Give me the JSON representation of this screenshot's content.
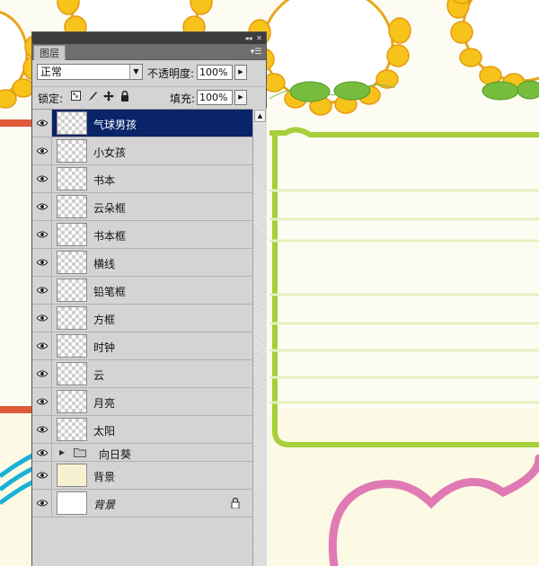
{
  "panel": {
    "tab_label": "图层",
    "collapse_icon": "double-chevron-left-icon",
    "close_icon": "close-icon",
    "menu_icon": "panel-menu-icon",
    "blend_mode": "正常",
    "opacity_label": "不透明度:",
    "opacity_value": "100%",
    "lock_label": "锁定:",
    "fill_label": "填充:",
    "fill_value": "100%"
  },
  "layers": [
    {
      "name": "气球男孩",
      "visible": true,
      "selected": true
    },
    {
      "name": "小女孩",
      "visible": true
    },
    {
      "name": "书本",
      "visible": true
    },
    {
      "name": "云朵框",
      "visible": true
    },
    {
      "name": "书本框",
      "visible": true
    },
    {
      "name": "横线",
      "visible": true
    },
    {
      "name": "铅笔框",
      "visible": true
    },
    {
      "name": "方框",
      "visible": true
    },
    {
      "name": "时钟",
      "visible": true
    },
    {
      "name": "云",
      "visible": true
    },
    {
      "name": "月亮",
      "visible": true
    },
    {
      "name": "太阳",
      "visible": true
    },
    {
      "name": "向日葵",
      "visible": true,
      "type": "group",
      "expanded": false
    },
    {
      "name": "背景",
      "visible": true
    },
    {
      "name": "背景",
      "visible": true,
      "locked": true,
      "italic": true
    }
  ],
  "colors": {
    "selection": "#0a246a",
    "panel_bg": "#d4d4d4",
    "sunflower": "#f7c21a",
    "leaf": "#6fb53a",
    "frame_green": "#a6cf3a",
    "heart_pink": "#e07ab4",
    "ruled_line": "#e7efc0"
  }
}
